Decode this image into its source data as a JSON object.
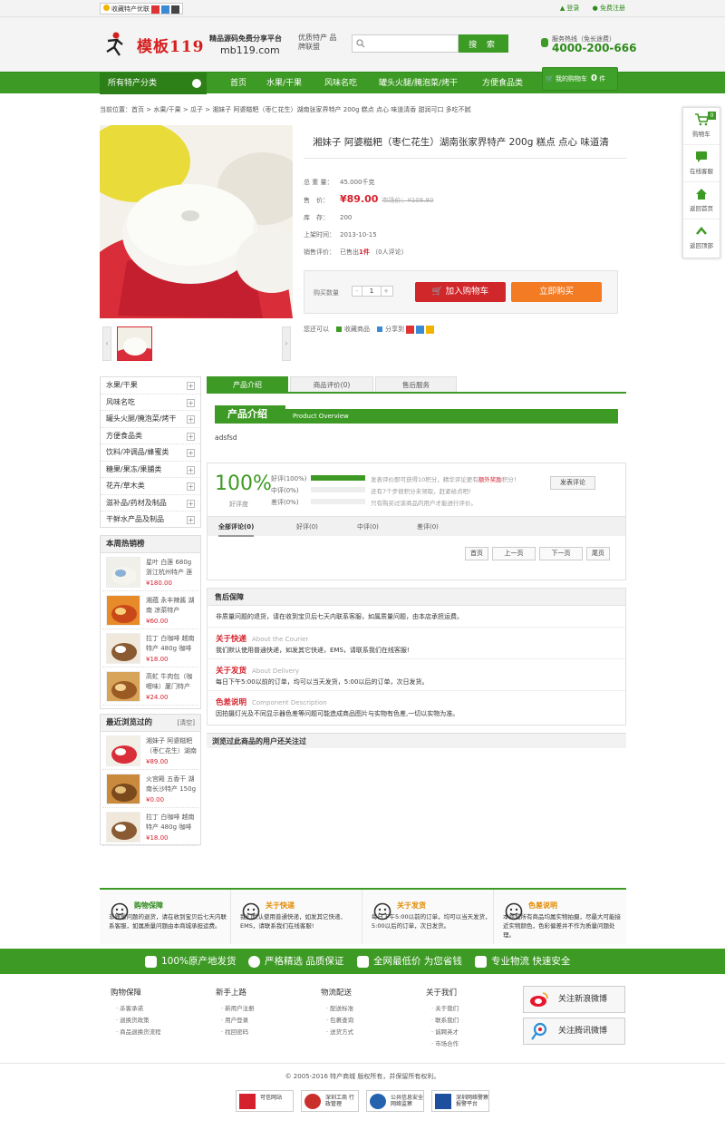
{
  "topbar": {
    "favorite": "收藏特产优联",
    "login": "登录",
    "register": "免费注册"
  },
  "header": {
    "brand": "模板119",
    "slogan": "精品源码免费分享平台",
    "domain": "mb119.com",
    "tagline": "优质特产 品牌联盟",
    "search_placeholder": "",
    "search_button": "搜 索",
    "hotline_label": "服务热线（免长途费）",
    "hotline": "4000-200-666"
  },
  "nav": {
    "all_categories": "所有特产分类",
    "items": [
      "首页",
      "水果/干果",
      "风味名吃",
      "罐头火腿/腌泡菜/烤干",
      "方便食品类"
    ],
    "cart_label": "我的购物车",
    "cart_count": "0",
    "cart_unit": "件"
  },
  "breadcrumb": "当前位置：首页 > 水果/干果 > 瓜子 > 湘妹子 阿婆糍粑（枣仁花生）湖南张家界特产 200g 糕点 点心 味道清香 甜润可口 多吃不腻",
  "product": {
    "title": "湘妹子 阿婆糍粑（枣仁花生）湖南张家界特产 200g 糕点 点心 味道清",
    "weight_label": "总 重 量：",
    "weight": "45.000千克",
    "price_label": "售　价：",
    "price": "¥89.00",
    "market_price": "市场价：¥106.80",
    "stock_label": "库　存：",
    "stock": "200",
    "date_label": "上架时间：",
    "date": "2013-10-15",
    "sales_label": "销售评价：",
    "sales": "已售出",
    "sales_count": "1件",
    "reviews": "（0人评论）",
    "qty_label": "购买数量",
    "qty": "1",
    "minus": "-",
    "plus": "+",
    "add_cart": "加入购物车",
    "buy_now": "立即购买",
    "also": "您还可以",
    "favorite": "收藏商品",
    "share": "分享到"
  },
  "categories": [
    "水果/干果",
    "风味名吃",
    "罐头火腿/腌泡菜/烤干",
    "方便食品类",
    "饮料/冲调品/蜂蜜类",
    "糖果/果冻/果脯类",
    "花卉/草木类",
    "滋补品/药材及制品",
    "干鲜水产品及制品"
  ],
  "hot": {
    "title": "本周热销榜",
    "items": [
      {
        "name": "星叶 白莲 680g 浙江杭州特产 莲",
        "price": "¥180.00"
      },
      {
        "name": "湘蕴 永丰辣酱 湖南 凉菜特产",
        "price": "¥60.00"
      },
      {
        "name": "拉丁 白咖啡 越南特产 480g 咖啡",
        "price": "¥18.00"
      },
      {
        "name": "高虻 牛肉包（咖喱味）厦门特产",
        "price": "¥24.00"
      }
    ]
  },
  "recent": {
    "title": "最近浏览过的",
    "clear": "[清空]",
    "items": [
      {
        "name": "湘妹子 阿婆糍粑（枣仁花生）湖南",
        "price": "¥89.00"
      },
      {
        "name": "火宫殿 五香干 湖南长沙特产 150g",
        "price": "¥0.00"
      },
      {
        "name": "拉丁 白咖啡 越南特产 480g 咖啡",
        "price": "¥18.00"
      }
    ]
  },
  "tabs": [
    "产品介绍",
    "商品评价(0)",
    "售后服务"
  ],
  "intro": {
    "title": "产品介绍",
    "subtitle": "Product Overview",
    "body": "adsfsd"
  },
  "review": {
    "pct": "100%",
    "pct_label": "好评度",
    "good": "好评(100%)",
    "mid": "中评(0%)",
    "bad": "差评(0%)",
    "good_ratio": 1.0,
    "mid_ratio": 0.0,
    "bad_ratio": 0.0,
    "note1a": "发表评价即可获得10积分，精华评论更有",
    "note1b": "额外奖励",
    "note1c": "积分！",
    "note2": "还有7个步很积分未领取，赶紧给点吧!",
    "note3": "只有购买过该商品的用户才能进行评价。",
    "post": "发表评论",
    "rtabs": [
      "全部评论(0)",
      "好评(0)",
      "中评(0)",
      "差评(0)"
    ],
    "pager": [
      "首页",
      "上一页",
      "下一页",
      "尾页"
    ]
  },
  "after": {
    "title": "售后保障",
    "intro": "非质量问题的退货，请在收到宝贝后七天内联系客服，如属质量问题，由本店承担运费。",
    "sections": [
      {
        "t": "关于快递",
        "en": "About the Courier",
        "d": "我们默认使用普通快递，如发其它快递，EMS，请联系我们在线客服!"
      },
      {
        "t": "关于发货",
        "en": "About Delivery",
        "d": "每日下午5:00以前的订单，均可以当天发货，5:00以后的订单，次日发货。"
      },
      {
        "t": "色差说明",
        "en": "Component Description",
        "d": "因拍摄灯光及不同显示器色差等问题可能造成商品图片与实物有色差,一切以实物为准。"
      }
    ]
  },
  "browsed": "浏览过此商品的用户还关注过",
  "rfloat": [
    "购物车",
    "在线客服",
    "返回首页",
    "返回顶部"
  ],
  "rfloat_badge": "0",
  "guarantee": [
    {
      "t": "购物保障",
      "d": "非质量问题的退货，请在收到宝贝后七天内联系客服，如属质量问题由本商城承担运费。"
    },
    {
      "t": "关于快递",
      "d": "我们默认使用普通快递，如发其它快递、EMS，请联系我们在线客服!"
    },
    {
      "t": "关于发货",
      "d": "每日下午5:00以前的订单，均可以当天发货，5:00以后的订单，次日发货。"
    },
    {
      "t": "色差说明",
      "d": "本商城所有商品均属实物拍摄，尽最大可能接近实物颜色，色彩偏差并不作为质量问题处理。"
    }
  ],
  "strip": [
    "100%原产地发货",
    "严格精选 品质保证",
    "全网最低价 为您省钱",
    "专业物流 快速安全"
  ],
  "footer": {
    "cols": [
      {
        "h": "购物保障",
        "l": [
          "杀客承诺",
          "退换货政策",
          "商品退换货流程"
        ]
      },
      {
        "h": "新手上路",
        "l": [
          "新用户注册",
          "用户登录",
          "找回密码"
        ]
      },
      {
        "h": "物流配送",
        "l": [
          "配送标准",
          "包裹查询",
          "送货方式"
        ]
      },
      {
        "h": "关于我们",
        "l": [
          "关于我们",
          "联系我们",
          "诚聘英才",
          "市场合作"
        ]
      }
    ],
    "weibo_sina": "关注新浪微博",
    "weibo_qq": "关注腾讯微博",
    "copyright": "© 2005-2016 特产商城 版权所有，并保留所有权利。",
    "badges": [
      "可信网站",
      "深圳工商 行政管理",
      "公共信息安全网络监察",
      "深圳网络警察 报警平台"
    ]
  },
  "colors": {
    "green": "#3d9a24",
    "dark_green": "#2d7f18",
    "red": "#d0272a",
    "orange": "#f27b24"
  }
}
